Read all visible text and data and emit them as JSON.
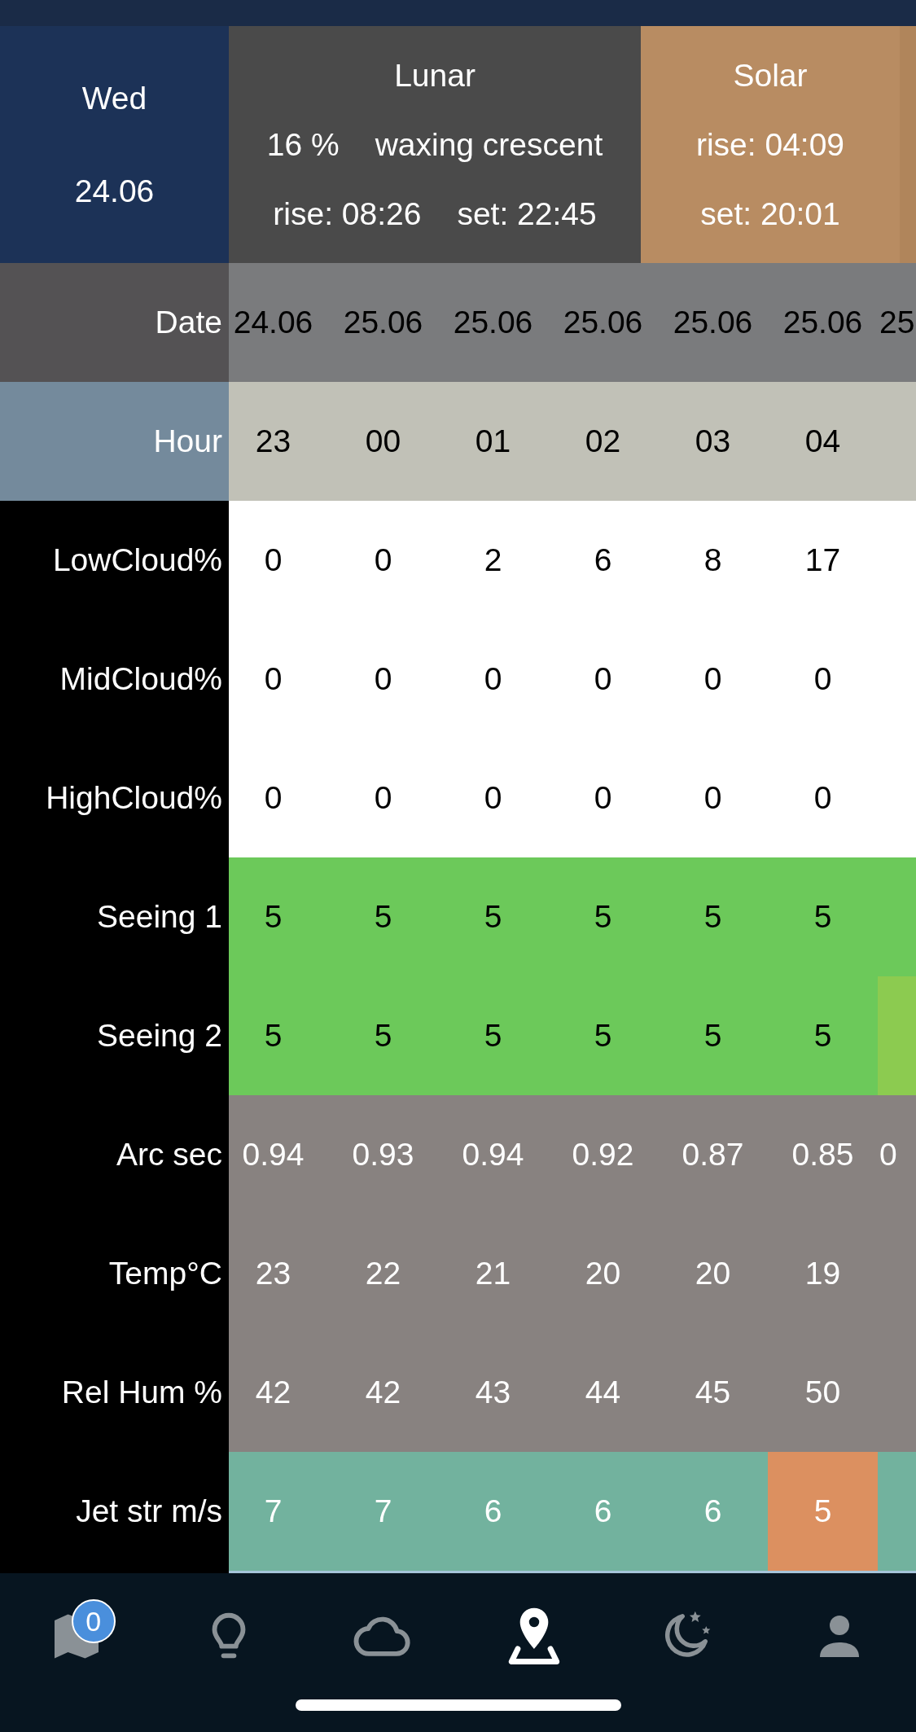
{
  "header": {
    "day": "Wed",
    "date": "24.06",
    "lunar": {
      "title": "Lunar",
      "illumination": "16 %",
      "phase": "waxing crescent",
      "rise": "rise: 08:26",
      "set": "set: 22:45"
    },
    "solar": {
      "title": "Solar",
      "rise": "rise: 04:09",
      "set": "set: 20:01"
    }
  },
  "table": {
    "rows": [
      {
        "label": "Date",
        "kind": "date",
        "cells": [
          {
            "text": "24.06"
          },
          {
            "text": "25.06"
          },
          {
            "text": "25.06"
          },
          {
            "text": "25.06"
          },
          {
            "text": "25.06"
          },
          {
            "text": "25.06"
          },
          {
            "text": "25"
          }
        ]
      },
      {
        "label": "Hour",
        "kind": "hour",
        "cells": [
          {
            "text": "23"
          },
          {
            "text": "00"
          },
          {
            "text": "01"
          },
          {
            "text": "02"
          },
          {
            "text": "03"
          },
          {
            "text": "04"
          }
        ]
      },
      {
        "label": "LowCloud%",
        "kind": "cloud",
        "cells": [
          {
            "text": "0"
          },
          {
            "text": "0"
          },
          {
            "text": "2"
          },
          {
            "text": "6"
          },
          {
            "text": "8"
          },
          {
            "text": "17"
          }
        ]
      },
      {
        "label": "MidCloud%",
        "kind": "cloud",
        "cells": [
          {
            "text": "0"
          },
          {
            "text": "0"
          },
          {
            "text": "0"
          },
          {
            "text": "0"
          },
          {
            "text": "0"
          },
          {
            "text": "0"
          }
        ]
      },
      {
        "label": "HighCloud%",
        "kind": "cloud",
        "cells": [
          {
            "text": "0"
          },
          {
            "text": "0"
          },
          {
            "text": "0"
          },
          {
            "text": "0"
          },
          {
            "text": "0"
          },
          {
            "text": "0"
          }
        ]
      },
      {
        "label": "Seeing 1",
        "kind": "seeing",
        "cells": [
          {
            "text": "5",
            "color": "#6cc95a"
          },
          {
            "text": "5",
            "color": "#6cc95a"
          },
          {
            "text": "5",
            "color": "#6cc95a"
          },
          {
            "text": "5",
            "color": "#6cc95a"
          },
          {
            "text": "5",
            "color": "#6cc95a"
          },
          {
            "text": "5",
            "color": "#6cc95a"
          },
          {
            "color": "#6cc95a"
          }
        ]
      },
      {
        "label": "Seeing 2",
        "kind": "seeing",
        "cells": [
          {
            "text": "5",
            "color": "#6cc95a"
          },
          {
            "text": "5",
            "color": "#6cc95a"
          },
          {
            "text": "5",
            "color": "#6cc95a"
          },
          {
            "text": "5",
            "color": "#6cc95a"
          },
          {
            "text": "5",
            "color": "#6cc95a"
          },
          {
            "text": "5",
            "color": "#6cc95a"
          },
          {
            "color": "#8ccb50"
          }
        ]
      },
      {
        "label": "Arc sec",
        "kind": "measure",
        "cells": [
          {
            "text": "0.94"
          },
          {
            "text": "0.93"
          },
          {
            "text": "0.94"
          },
          {
            "text": "0.92"
          },
          {
            "text": "0.87"
          },
          {
            "text": "0.85"
          },
          {
            "text": "0"
          }
        ]
      },
      {
        "label": "Temp°C",
        "kind": "measure",
        "cells": [
          {
            "text": "23"
          },
          {
            "text": "22"
          },
          {
            "text": "21"
          },
          {
            "text": "20"
          },
          {
            "text": "20"
          },
          {
            "text": "19"
          }
        ]
      },
      {
        "label": "Rel Hum %",
        "kind": "measure",
        "cells": [
          {
            "text": "42"
          },
          {
            "text": "42"
          },
          {
            "text": "43"
          },
          {
            "text": "44"
          },
          {
            "text": "45"
          },
          {
            "text": "50"
          }
        ]
      },
      {
        "label": "Jet str m/s",
        "kind": "jet",
        "cells": [
          {
            "text": "7",
            "color": "#72b29e"
          },
          {
            "text": "7",
            "color": "#72b29e"
          },
          {
            "text": "6",
            "color": "#72b29e"
          },
          {
            "text": "6",
            "color": "#72b29e"
          },
          {
            "text": "6",
            "color": "#72b29e"
          },
          {
            "text": "5",
            "color": "#dc9060"
          },
          {
            "color": "#72b29e"
          }
        ]
      }
    ]
  },
  "nav": {
    "tabs": [
      {
        "kind": "map",
        "selected": false,
        "badge": "0"
      },
      {
        "kind": "bulb",
        "selected": false
      },
      {
        "kind": "cloud",
        "selected": false
      },
      {
        "kind": "pin",
        "selected": true
      },
      {
        "kind": "moon",
        "selected": false
      },
      {
        "kind": "person",
        "selected": false
      }
    ]
  }
}
